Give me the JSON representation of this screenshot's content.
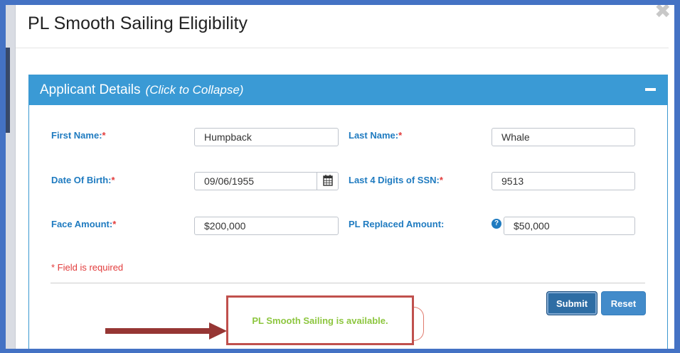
{
  "modal": {
    "title": "PL Smooth Sailing Eligibility",
    "close_glyph": "✖"
  },
  "panel": {
    "title": "Applicant Details",
    "hint": "(Click to Collapse)"
  },
  "form": {
    "first_name": {
      "label": "First Name:",
      "value": "Humpback"
    },
    "last_name": {
      "label": "Last Name:",
      "value": "Whale"
    },
    "dob": {
      "label": "Date Of Birth:",
      "value": "09/06/1955"
    },
    "ssn4": {
      "label": "Last 4 Digits of SSN:",
      "value": "9513"
    },
    "face_amount": {
      "label": "Face Amount:",
      "value": "$200,000"
    },
    "pl_replaced": {
      "label": "PL Replaced Amount:",
      "value": "$50,000"
    },
    "required_mark": "*",
    "required_note": "* Field is required",
    "help_glyph": "?"
  },
  "buttons": {
    "submit": "Submit",
    "reset": "Reset"
  },
  "result": {
    "message": "PL Smooth Sailing is available."
  },
  "colors": {
    "accent": "#3a9ad5",
    "label": "#1f7bc0",
    "required": "#e23b3b",
    "success": "#8dc63f",
    "callout_border": "#c0504d",
    "arrow": "#963634"
  }
}
